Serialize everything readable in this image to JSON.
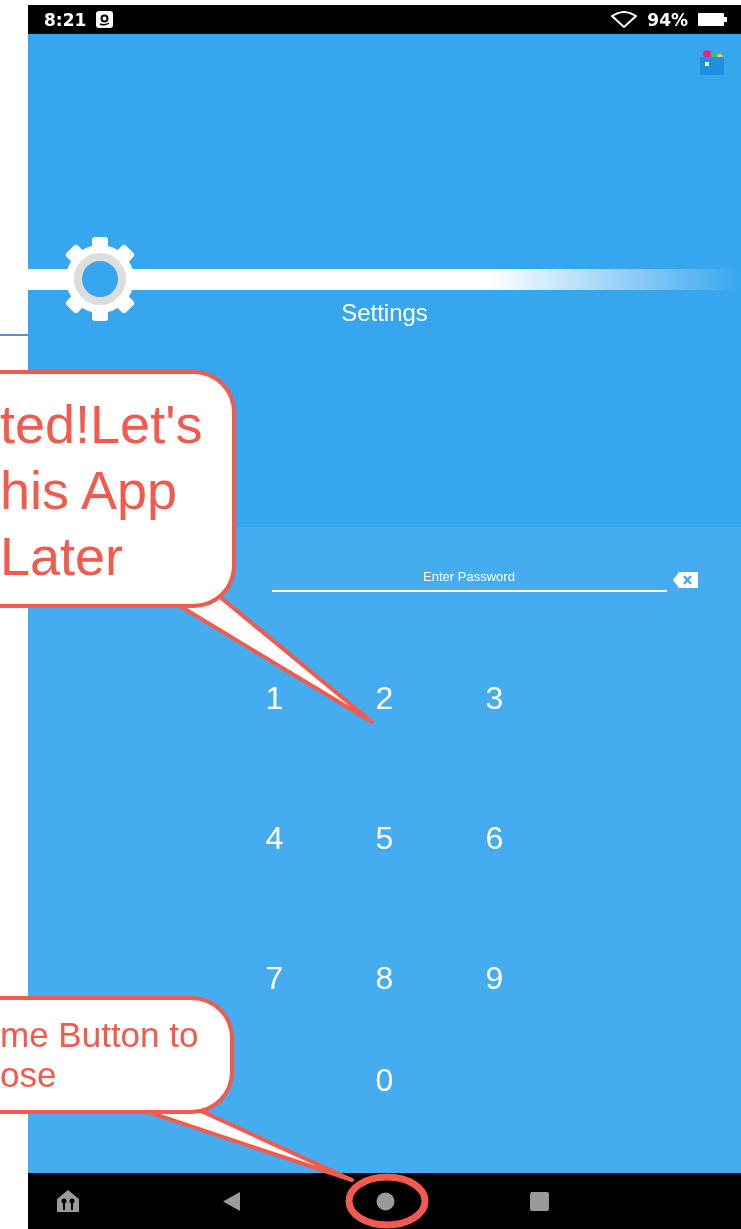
{
  "status_bar": {
    "time": "8:21",
    "battery": "94%"
  },
  "header": {
    "title": "Settings"
  },
  "password": {
    "placeholder": "Enter Password"
  },
  "keypad": [
    [
      "1",
      "2",
      "3"
    ],
    [
      "4",
      "5",
      "6"
    ],
    [
      "7",
      "8",
      "9"
    ],
    [
      "0"
    ]
  ],
  "callouts": [
    {
      "lines": [
        "ted!Let's",
        "his App",
        "Later"
      ]
    },
    {
      "lines": [
        "me Button to",
        "ose"
      ]
    }
  ]
}
